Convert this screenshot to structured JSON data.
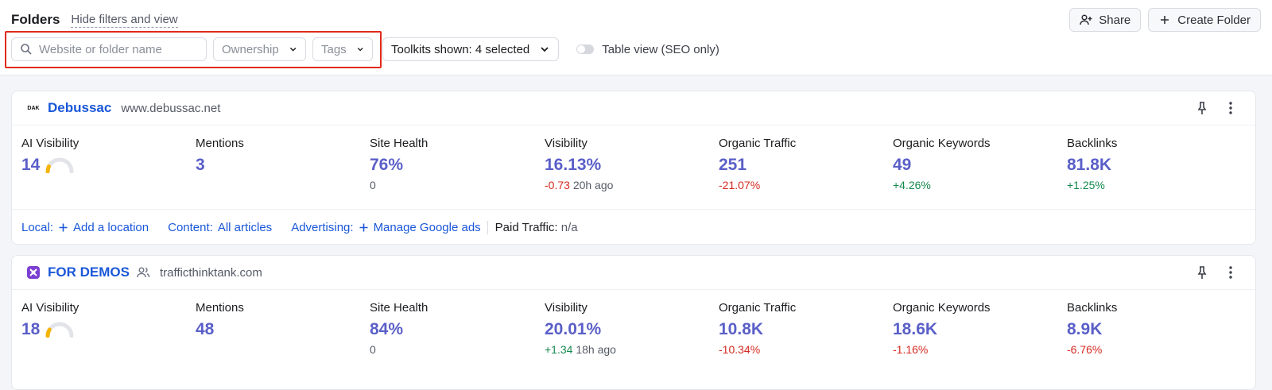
{
  "header": {
    "title": "Folders",
    "hide_link": "Hide filters and view",
    "share_label": "Share",
    "create_label": "Create Folder"
  },
  "filters": {
    "search_placeholder": "Website or folder name",
    "ownership_label": "Ownership",
    "tags_label": "Tags",
    "toolkits_label": "Toolkits shown: 4 selected",
    "table_view_label": "Table view (SEO only)"
  },
  "projects": [
    {
      "name": "Debussac",
      "domain": "www.debussac.net",
      "logo_text": "DAK",
      "metrics": {
        "ai_visibility": {
          "label": "AI Visibility",
          "value": "14",
          "gauge_fraction": 0.14
        },
        "mentions": {
          "label": "Mentions",
          "value": "3"
        },
        "site_health": {
          "label": "Site Health",
          "value": "76%",
          "sub": "0"
        },
        "visibility": {
          "label": "Visibility",
          "value": "16.13%",
          "delta": "-0.73",
          "time": "20h ago"
        },
        "organic_traffic": {
          "label": "Organic Traffic",
          "value": "251",
          "delta": "-21.07%"
        },
        "organic_keywords": {
          "label": "Organic Keywords",
          "value": "49",
          "delta": "+4.26%"
        },
        "backlinks": {
          "label": "Backlinks",
          "value": "81.8K",
          "delta": "+1.25%"
        }
      },
      "footer": {
        "local_label": "Local:",
        "local_link": "Add a location",
        "content_label": "Content:",
        "content_link": "All articles",
        "advertising_label": "Advertising:",
        "advertising_link": "Manage Google ads",
        "paid_label": "Paid Traffic:",
        "paid_value": "n/a"
      }
    },
    {
      "name": "FOR DEMOS",
      "domain": "trafficthinktank.com",
      "metrics": {
        "ai_visibility": {
          "label": "AI Visibility",
          "value": "18",
          "gauge_fraction": 0.18
        },
        "mentions": {
          "label": "Mentions",
          "value": "48"
        },
        "site_health": {
          "label": "Site Health",
          "value": "84%",
          "sub": "0"
        },
        "visibility": {
          "label": "Visibility",
          "value": "20.01%",
          "delta": "+1.34",
          "time": "18h ago"
        },
        "organic_traffic": {
          "label": "Organic Traffic",
          "value": "10.8K",
          "delta": "-10.34%"
        },
        "organic_keywords": {
          "label": "Organic Keywords",
          "value": "18.6K",
          "delta": "-1.16%"
        },
        "backlinks": {
          "label": "Backlinks",
          "value": "8.9K",
          "delta": "-6.76%"
        }
      }
    }
  ],
  "colors": {
    "link": "#1a57d8",
    "metric_value": "#5a5fc8",
    "negative": "#d42a1f",
    "positive": "#16894e",
    "highlight": "#e02a1b",
    "gauge_fill": "#f4b400"
  }
}
